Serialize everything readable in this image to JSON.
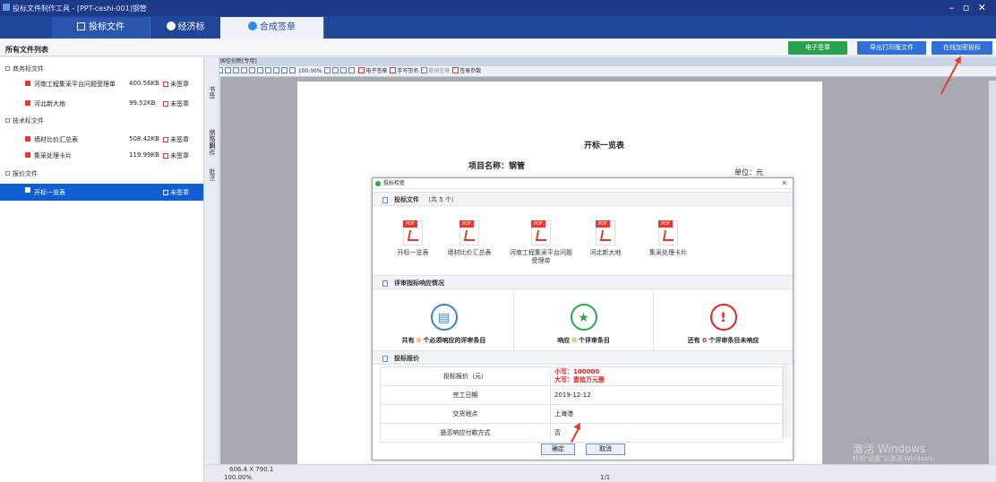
{
  "window": {
    "title": "投标文件制作工具 - [PPT-ceshi-001]钢管",
    "controls": "– ▫ ✕"
  },
  "tabs": [
    {
      "label": "投标文件"
    },
    {
      "label": "经济标"
    },
    {
      "label": "合成签章"
    }
  ],
  "left_panel": {
    "title": "所有文件列表",
    "groups": [
      {
        "label": "商务标文件"
      },
      {
        "label": "技术标文件"
      },
      {
        "label": "报价文件"
      }
    ],
    "files": [
      {
        "name": "河南工程集采平台问题受理单",
        "size": "400.56KB",
        "status": "未签章"
      },
      {
        "name": "河北新大地",
        "size": "99.52KB",
        "status": "未签章"
      },
      {
        "name": "墙材比价汇总表",
        "size": "508.42KB",
        "status": "未签章"
      },
      {
        "name": "集采处理卡片",
        "size": "119.99KB",
        "status": "未签章"
      },
      {
        "name": "开标一览表",
        "size": "",
        "status": "未签章"
      }
    ]
  },
  "top_buttons": {
    "esign": "电子签章",
    "export": "导出打印版文件",
    "encrypt": "在线加密投标"
  },
  "viewer": {
    "title": "国信创新[专用]",
    "zoom_text": "100.00%",
    "tool_labels": [
      "电子签章",
      "手写签名",
      "撤销签章",
      "签章参数"
    ],
    "side_tabs": [
      "书签",
      "缩略图",
      "附件",
      "批注"
    ]
  },
  "document": {
    "title": "开标一览表",
    "project": "项目名称：钢管",
    "unit": "单位：元"
  },
  "status_bar": {
    "size": "606.4 X 790.1 ",
    "zoom": "100.00%",
    "page": "1/1"
  },
  "watermark": {
    "line1": "激活 Windows",
    "line2": "转到\"设置\"以激活 Windows。"
  },
  "dialog": {
    "title": "投标检查",
    "files_section": "投标文件",
    "files_count": "（共 5 个）",
    "pdf_files": [
      "开标一览表",
      "墙材比价汇总表",
      "河南工程集采平台问题受理单",
      "河北新大地",
      "集采处理卡片"
    ],
    "eval_section": "评审指标响应情况",
    "stats": [
      {
        "pre": "共有",
        "num": "0",
        "post": "个必须响应的评审条目",
        "color": "#2f86d8"
      },
      {
        "pre": "响应",
        "num": "0",
        "post": "个评审条目",
        "color": "#2ea34a"
      },
      {
        "pre": "还有",
        "num": "0",
        "post": "个评审条目未响应",
        "color": "#e02020"
      }
    ],
    "price_section": "投标报价",
    "rows": [
      {
        "key": "投标报价（元）",
        "v1": "小写：100000",
        "v2": "大写：壹拾万元整"
      },
      {
        "key": "完工日期",
        "v": "2019-12-12"
      },
      {
        "key": "交货地点",
        "v": "上海港"
      },
      {
        "key": "是否响应付款方式",
        "v": "否"
      }
    ],
    "ok": "确定",
    "cancel": "取消"
  }
}
